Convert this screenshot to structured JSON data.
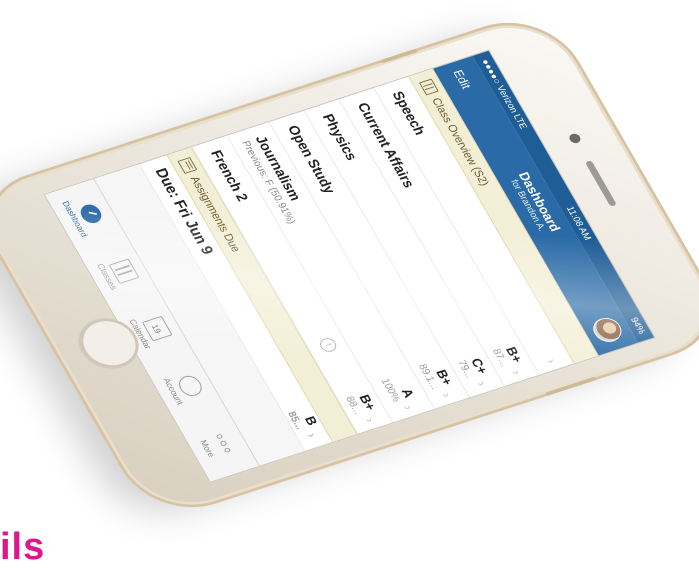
{
  "status_bar": {
    "carrier": "●●●●○ Verizon",
    "network": "LTE",
    "time": "11:08 AM",
    "battery": "94%"
  },
  "nav": {
    "edit_label": "Edit",
    "title": "Dashboard",
    "subtitle": "for Brandon A."
  },
  "class_overview": {
    "header": "Class Overview (S2)",
    "rows": [
      {
        "name": "Speech",
        "grade": "",
        "percent": ""
      },
      {
        "name": "Current Affairs",
        "grade": "B+",
        "percent": "87..."
      },
      {
        "name": "Physics",
        "grade": "C+",
        "percent": "79..."
      },
      {
        "name": "Open Study",
        "grade": "B+",
        "percent": "89.1..."
      },
      {
        "name": "Journalism",
        "sub": "Previous: F (50.91%)",
        "grade": "A",
        "percent": "100%"
      },
      {
        "name": "French 2",
        "grade": "B+",
        "percent": "88..."
      }
    ]
  },
  "assignments": {
    "header": "Assignments Due",
    "due_label": "Due: Fri Jun 9",
    "extra_grade": "B",
    "extra_percent": "85..."
  },
  "tabs": [
    {
      "label": "Dashboard",
      "icon": "dashboard-icon",
      "active": true
    },
    {
      "label": "Classes",
      "icon": "classes-icon",
      "active": false
    },
    {
      "label": "Calendar",
      "icon": "calendar-icon",
      "day": "19",
      "active": false
    },
    {
      "label": "Account",
      "icon": "account-icon",
      "active": false
    },
    {
      "label": "More",
      "icon": "more-icon",
      "active": false
    }
  ],
  "colors": {
    "accent": "#2a6aa6",
    "section_bg": "#f3efd7",
    "brand_text": "#e0168c"
  },
  "corner_text": "ils"
}
